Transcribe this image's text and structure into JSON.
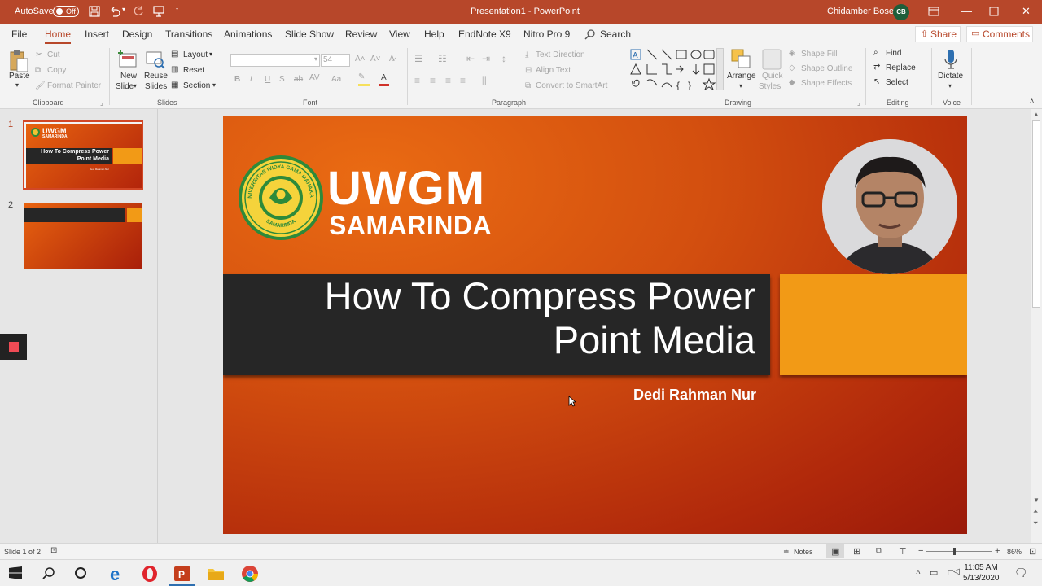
{
  "titlebar": {
    "autosave_label": "AutoSave",
    "autosave_state": "Off",
    "document_title": "Presentation1 - PowerPoint",
    "user_name": "Chidamber Bose",
    "user_initials": "CB"
  },
  "tabs": [
    "File",
    "Home",
    "Insert",
    "Design",
    "Transitions",
    "Animations",
    "Slide Show",
    "Review",
    "View",
    "Help",
    "EndNote X9",
    "Nitro Pro 9"
  ],
  "active_tab": "Home",
  "search_label": "Search",
  "share_label": "Share",
  "comments_label": "Comments",
  "ribbon": {
    "clipboard": {
      "paste": "Paste",
      "cut": "Cut",
      "copy": "Copy",
      "format_painter": "Format Painter",
      "group": "Clipboard"
    },
    "slides": {
      "new_slide_1": "New",
      "new_slide_2": "Slide",
      "reuse_1": "Reuse",
      "reuse_2": "Slides",
      "layout": "Layout",
      "reset": "Reset",
      "section": "Section",
      "group": "Slides"
    },
    "font": {
      "size": "54",
      "group": "Font"
    },
    "paragraph": {
      "text_direction": "Text Direction",
      "align_text": "Align Text",
      "smartart": "Convert to SmartArt",
      "group": "Paragraph"
    },
    "drawing": {
      "arrange": "Arrange",
      "quick_1": "Quick",
      "quick_2": "Styles",
      "shape_fill": "Shape Fill",
      "shape_outline": "Shape Outline",
      "shape_effects": "Shape Effects",
      "group": "Drawing"
    },
    "editing": {
      "find": "Find",
      "replace": "Replace",
      "select": "Select",
      "group": "Editing"
    },
    "voice": {
      "dictate": "Dictate",
      "group": "Voice"
    }
  },
  "thumbnails": [
    {
      "number": "1",
      "title": "How To Compress Power Point Media",
      "logo": "UWGM",
      "logo_sub": "SAMARINDA",
      "author": "Dedi Rahman Nur"
    },
    {
      "number": "2"
    }
  ],
  "slide": {
    "title": "How To Compress Power\nPoint Media",
    "author": "Dedi Rahman Nur",
    "logo_text": "UWGM",
    "logo_subtext": "SAMARINDA",
    "seal_text": "UNIVERSITAS WIDYA GAMA MAHAKAM",
    "seal_bottom": "SAMARINDA"
  },
  "status": {
    "slide_counter": "Slide 1 of 2",
    "notes": "Notes",
    "zoom": "86%"
  },
  "taskbar": {
    "time": "11:05 AM",
    "date": "5/13/2020"
  },
  "colors": {
    "accent": "#b7472a",
    "slide_orange": "#f29a16",
    "band": "#262626"
  }
}
